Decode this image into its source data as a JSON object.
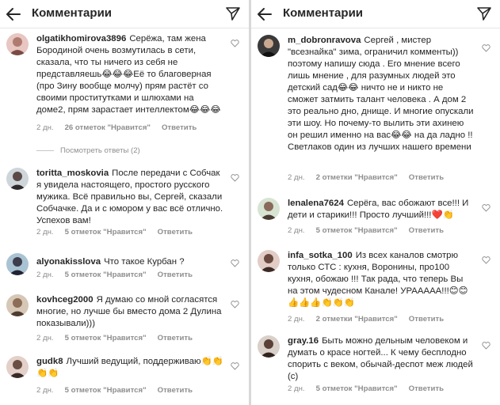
{
  "colors": {
    "text": "#262626",
    "muted": "#8e8e8e",
    "border": "#e6e6e6"
  },
  "icons": {
    "back": "arrow-left-icon",
    "share": "send-icon",
    "like": "heart-icon"
  },
  "left": {
    "title": "Комментарии",
    "comments": [
      {
        "username": "olgatikhomirova3896",
        "text": "Серёжа, там жена Бородиной очень возмутилась в сети, сказала, что ты ничего из себя не представляешь😂😂😂Её то благоверная (про Зину вообще молчу) прям растёт со своими проститутками и шлюхами на доме2, прям зарастает интеллектом😂😂😂",
        "time": "2 дн.",
        "likes": "26 отметок \"Нравится\"",
        "reply": "Ответить"
      },
      {
        "username": "toritta_moskovia",
        "text": "После передачи с Собчак я увидела настоящего, простого русского мужика. Всё правильно вы, Сергей, сказали Собчачке. Да и с юмором у вас всё отлично. Успехов вам!",
        "time": "2 дн.",
        "likes": "5 отметок \"Нравится\"",
        "reply": "Ответить"
      },
      {
        "username": "alyonakisslova",
        "text": "Что такое Курбан ?",
        "time": "2 дн.",
        "likes": "5 отметок \"Нравится\"",
        "reply": "Ответить"
      },
      {
        "username": "kovhceg2000",
        "text": "Я думаю со мной согласятся многие, но лучше бы вместо дома 2 Дулина показывали)))",
        "time": "2 дн.",
        "likes": "5 отметок \"Нравится\"",
        "reply": "Ответить"
      },
      {
        "username": "gudk8",
        "text": "Лучший ведущий, поддерживаю👏👏👏👏",
        "time": "2 дн.",
        "likes": "5 отметок \"Нравится\"",
        "reply": "Ответить"
      }
    ],
    "view_replies": "Посмотреть ответы (2)"
  },
  "right": {
    "title": "Комментарии",
    "comments": [
      {
        "username": "m_dobronravova",
        "text": "Сергей , мистер \"всезнайка\" зима, ограничил комменты)) поэтому напишу сюда . Его мнение всего лишь мнение , для разумных людей это детский сад😂😂 ничто не и никто не сможет затмить талант человека . А дом 2 это реально дно, днище. И многие опускали эти шоу. Но почему-то вылить эти ахинею он решил именно на вас😂😂 на да ладно !! Светлаков один из лучших нашего времени",
        "time": "2 дн.",
        "likes": "2 отметки \"Нравится\"",
        "reply": "Ответить"
      },
      {
        "username": "lenalena7624",
        "text": "Серёга, вас обожают все!!! И дети и старики!!! Просто лучший!!!❤️👏",
        "time": "2 дн.",
        "likes": "5 отметок \"Нравится\"",
        "reply": "Ответить"
      },
      {
        "username": "infa_sotka_100",
        "text": "Из всех каналов смотрю только СТС : кухня, Воронины, про100 кухня, обожаю !!! Так рада, что теперь Вы на этом чудесном Канале! УРААААА!!!😊😊👍👍👍👏👏👏",
        "time": "2 дн.",
        "likes": "2 отметки \"Нравится\"",
        "reply": "Ответить"
      },
      {
        "username": "gray.16",
        "text": "Быть можно дельным человеком и думать о красе ногтей... К чему бесплодно спорить с веком, обычай-деспот меж людей (с)",
        "time": "2 дн.",
        "likes": "5 отметок \"Нравится\"",
        "reply": "Ответить"
      }
    ]
  }
}
